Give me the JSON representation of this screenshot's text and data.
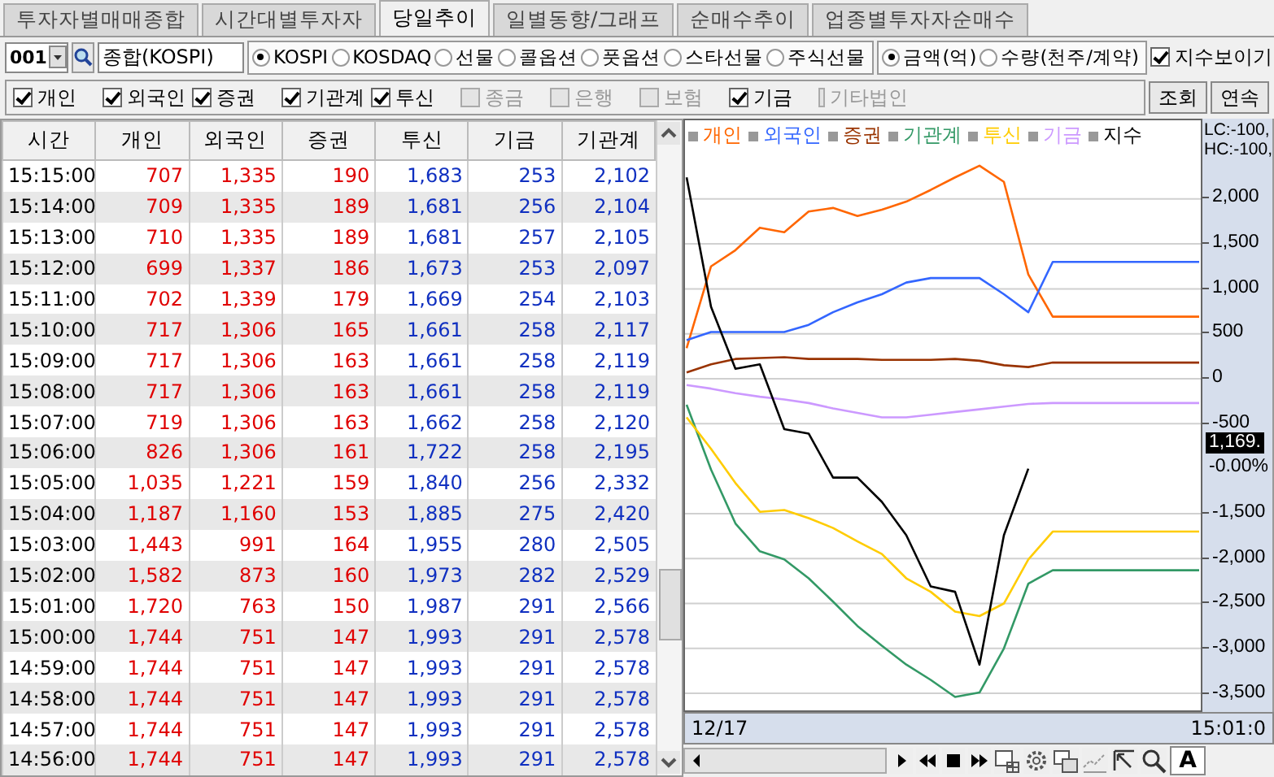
{
  "tabs": [
    {
      "label": "투자자별매매종합",
      "selected": false
    },
    {
      "label": "시간대별투자자",
      "selected": false
    },
    {
      "label": "당일추이",
      "selected": true
    },
    {
      "label": "일별동향/그래프",
      "selected": false
    },
    {
      "label": "순매수추이",
      "selected": false
    },
    {
      "label": "업종별투자자순매수",
      "selected": false
    }
  ],
  "toolbar": {
    "code": "001",
    "market_name": "종합(KOSPI)",
    "markets": [
      {
        "label": "KOSPI",
        "selected": true
      },
      {
        "label": "KOSDAQ",
        "selected": false
      },
      {
        "label": "선물",
        "selected": false
      },
      {
        "label": "콜옵션",
        "selected": false
      },
      {
        "label": "풋옵션",
        "selected": false
      },
      {
        "label": "스타선물",
        "selected": false
      },
      {
        "label": "주식선물",
        "selected": false
      }
    ],
    "units": [
      {
        "label": "금액(억)",
        "selected": true
      },
      {
        "label": "수량(천주/계약)",
        "selected": false
      }
    ],
    "show_index": {
      "label": "지수보이기",
      "checked": true
    }
  },
  "filters": [
    {
      "label": "개인",
      "checked": true,
      "disabled": false
    },
    {
      "label": "외국인",
      "checked": true,
      "disabled": false
    },
    {
      "label": "증권",
      "checked": true,
      "disabled": false
    },
    {
      "label": "기관계",
      "checked": true,
      "disabled": false
    },
    {
      "label": "투신",
      "checked": true,
      "disabled": false
    },
    {
      "label": "종금",
      "checked": false,
      "disabled": true
    },
    {
      "label": "은행",
      "checked": false,
      "disabled": true
    },
    {
      "label": "보험",
      "checked": false,
      "disabled": true
    },
    {
      "label": "기금",
      "checked": true,
      "disabled": false
    },
    {
      "label": "기타법인",
      "checked": false,
      "disabled": true
    }
  ],
  "buttons": [
    "조회",
    "연속"
  ],
  "table": {
    "columns": [
      {
        "label": "시간",
        "color": "#000000"
      },
      {
        "label": "개인",
        "color": "#e00000"
      },
      {
        "label": "외국인",
        "color": "#e00000"
      },
      {
        "label": "증권",
        "color": "#e00000"
      },
      {
        "label": "투신",
        "color": "#1030c0"
      },
      {
        "label": "기금",
        "color": "#1030c0"
      },
      {
        "label": "기관계",
        "color": "#1030c0"
      }
    ],
    "rows": [
      [
        "15:15:00",
        "707",
        "1,335",
        "190",
        "1,683",
        "253",
        "2,102"
      ],
      [
        "15:14:00",
        "709",
        "1,335",
        "189",
        "1,681",
        "256",
        "2,104"
      ],
      [
        "15:13:00",
        "710",
        "1,335",
        "189",
        "1,681",
        "257",
        "2,105"
      ],
      [
        "15:12:00",
        "699",
        "1,337",
        "186",
        "1,673",
        "253",
        "2,097"
      ],
      [
        "15:11:00",
        "702",
        "1,339",
        "179",
        "1,669",
        "254",
        "2,103"
      ],
      [
        "15:10:00",
        "717",
        "1,306",
        "165",
        "1,661",
        "258",
        "2,117"
      ],
      [
        "15:09:00",
        "717",
        "1,306",
        "163",
        "1,661",
        "258",
        "2,119"
      ],
      [
        "15:08:00",
        "717",
        "1,306",
        "163",
        "1,661",
        "258",
        "2,119"
      ],
      [
        "15:07:00",
        "719",
        "1,306",
        "163",
        "1,662",
        "258",
        "2,120"
      ],
      [
        "15:06:00",
        "826",
        "1,306",
        "161",
        "1,722",
        "258",
        "2,195"
      ],
      [
        "15:05:00",
        "1,035",
        "1,221",
        "159",
        "1,840",
        "256",
        "2,332"
      ],
      [
        "15:04:00",
        "1,187",
        "1,160",
        "153",
        "1,885",
        "275",
        "2,420"
      ],
      [
        "15:03:00",
        "1,443",
        "991",
        "164",
        "1,955",
        "280",
        "2,505"
      ],
      [
        "15:02:00",
        "1,582",
        "873",
        "160",
        "1,973",
        "282",
        "2,529"
      ],
      [
        "15:01:00",
        "1,720",
        "763",
        "150",
        "1,987",
        "291",
        "2,566"
      ],
      [
        "15:00:00",
        "1,744",
        "751",
        "147",
        "1,993",
        "291",
        "2,578"
      ],
      [
        "14:59:00",
        "1,744",
        "751",
        "147",
        "1,993",
        "291",
        "2,578"
      ],
      [
        "14:58:00",
        "1,744",
        "751",
        "147",
        "1,993",
        "291",
        "2,578"
      ],
      [
        "14:57:00",
        "1,744",
        "751",
        "147",
        "1,993",
        "291",
        "2,578"
      ],
      [
        "14:56:00",
        "1,744",
        "751",
        "147",
        "1,993",
        "291",
        "2,578"
      ]
    ]
  },
  "chart": {
    "chart_data": {
      "type": "line",
      "grid": true,
      "ylim": [
        -3725,
        2875
      ],
      "yticks": [
        {
          "value": 2000,
          "label": "2,000"
        },
        {
          "value": 1500,
          "label": "1,500"
        },
        {
          "value": 1000,
          "label": "1,000"
        },
        {
          "value": 500,
          "label": "500"
        },
        {
          "value": 0,
          "label": "0"
        },
        {
          "value": -500,
          "label": "-500"
        },
        {
          "value": -1500,
          "label": "-1,500"
        },
        {
          "value": -2000,
          "label": "-2,000"
        },
        {
          "value": -2500,
          "label": "-2,500"
        },
        {
          "value": -3000,
          "label": "-3,000"
        },
        {
          "value": -3500,
          "label": "-3,500"
        }
      ],
      "series": [
        {
          "name": "개인",
          "color": "#ff6600",
          "values": [
            340,
            1250,
            1430,
            1680,
            1630,
            1860,
            1900,
            1810,
            1880,
            1970,
            2100,
            2240,
            2370,
            2190,
            1160,
            690,
            690,
            690,
            690,
            690,
            690,
            690
          ]
        },
        {
          "name": "외국인",
          "color": "#3366ff",
          "values": [
            430,
            520,
            520,
            520,
            520,
            600,
            740,
            850,
            940,
            1070,
            1120,
            1120,
            1120,
            940,
            740,
            1300,
            1300,
            1300,
            1300,
            1300,
            1300,
            1300
          ]
        },
        {
          "name": "증권",
          "color": "#993300",
          "values": [
            70,
            160,
            220,
            230,
            240,
            220,
            220,
            220,
            210,
            210,
            210,
            220,
            200,
            150,
            130,
            180,
            180,
            180,
            180,
            180,
            180,
            180
          ]
        },
        {
          "name": "기관계",
          "color": "#339966",
          "values": [
            -290,
            -1010,
            -1610,
            -1920,
            -2010,
            -2220,
            -2480,
            -2750,
            -2970,
            -3180,
            -3350,
            -3540,
            -3490,
            -3000,
            -2280,
            -2130,
            -2130,
            -2130,
            -2130,
            -2130,
            -2130,
            -2130
          ]
        },
        {
          "name": "투신",
          "color": "#ffcc00",
          "values": [
            -430,
            -780,
            -1160,
            -1480,
            -1460,
            -1550,
            -1660,
            -1810,
            -1950,
            -2220,
            -2370,
            -2590,
            -2640,
            -2500,
            -2010,
            -1700,
            -1700,
            -1700,
            -1700,
            -1700,
            -1700,
            -1700
          ]
        },
        {
          "name": "기금",
          "color": "#cc99ff",
          "values": [
            -70,
            -110,
            -160,
            -200,
            -230,
            -270,
            -330,
            -380,
            -430,
            -430,
            -400,
            -370,
            -340,
            -310,
            -280,
            -270,
            -270,
            -270,
            -270,
            -270,
            -270,
            -270
          ]
        },
        {
          "name": "지수",
          "color": "#000000",
          "values": [
            2240,
            800,
            110,
            160,
            -560,
            -610,
            -1100,
            -1100,
            -1370,
            -1740,
            -2310,
            -2370,
            -3180,
            -1740,
            -1000,
            null,
            null,
            null,
            null,
            null,
            null,
            null
          ]
        }
      ]
    },
    "range_labels": [
      "LC:-100,",
      "HC:-100,"
    ],
    "current_value": "1,169.",
    "current_change": "-0.00%",
    "date": "12/17",
    "time": "15:01:0",
    "toolbar_text": "A"
  }
}
